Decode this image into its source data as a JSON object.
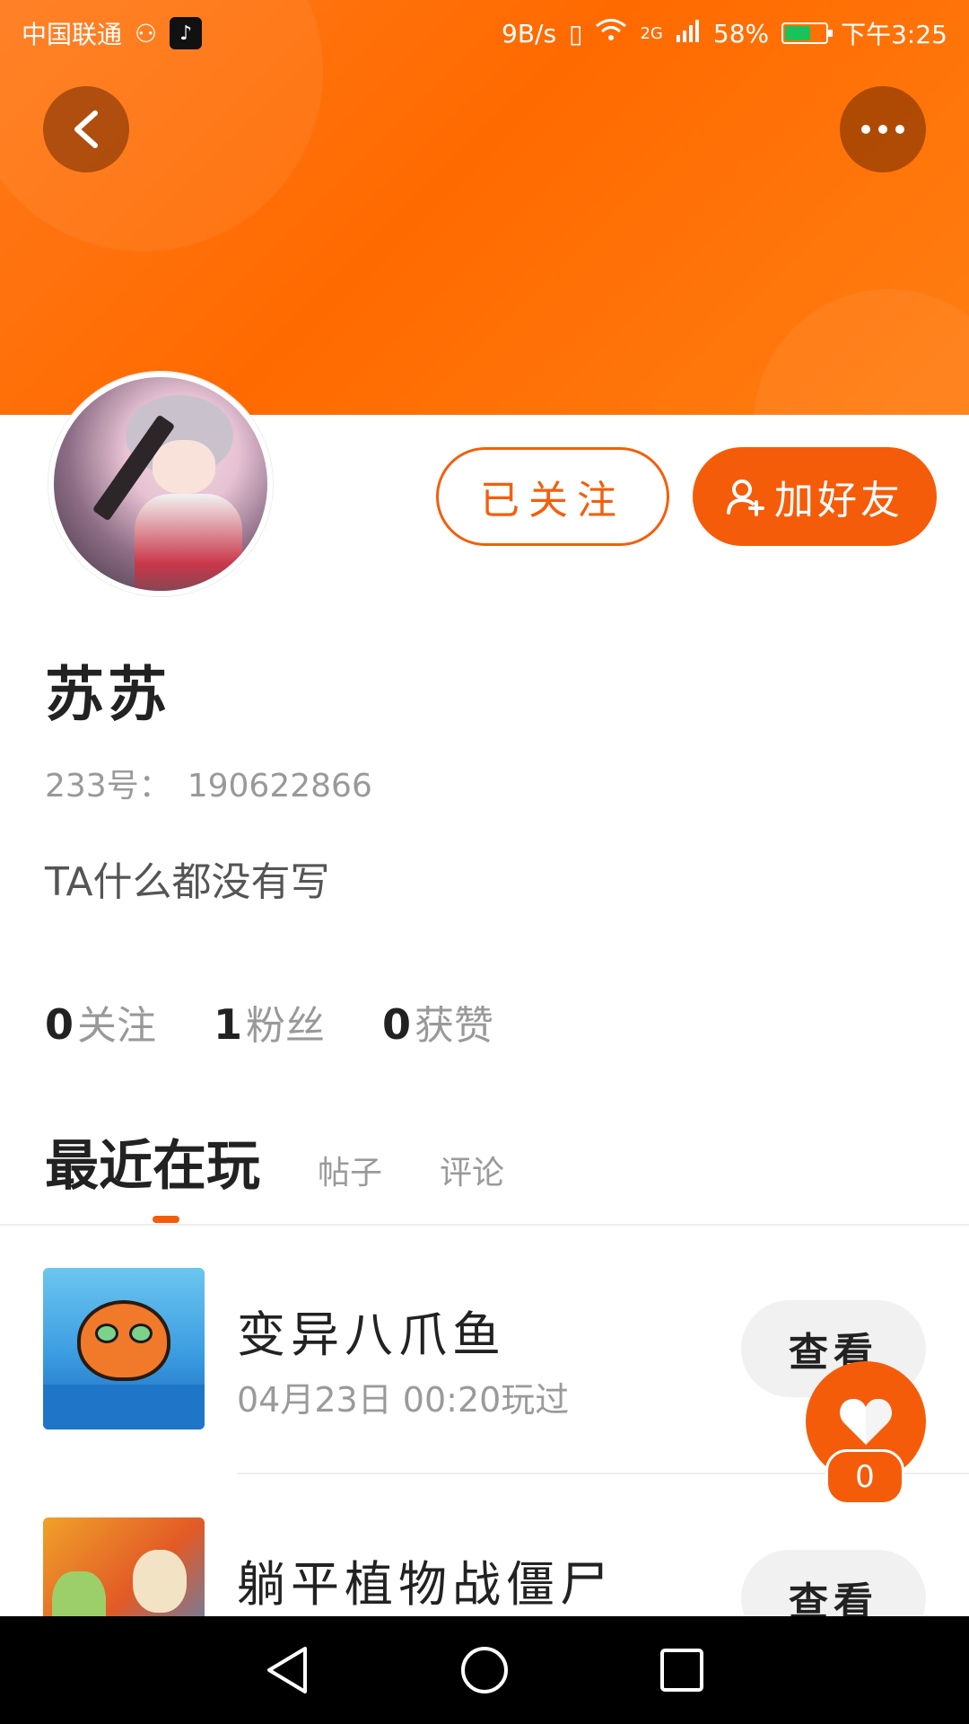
{
  "status_bar": {
    "carrier": "中国联通",
    "net_speed": "9B/s",
    "network": "2G",
    "battery": "58%",
    "time": "下午3:25"
  },
  "profile": {
    "name": "苏苏",
    "id_label": "233号：",
    "id_value": "190622866",
    "bio": "TA什么都没有写",
    "follow_button": "已关注",
    "add_friend_button": "加好友"
  },
  "stats": [
    {
      "count": "0",
      "label": "关注"
    },
    {
      "count": "1",
      "label": "粉丝"
    },
    {
      "count": "0",
      "label": "获赞"
    }
  ],
  "tabs": [
    {
      "label": "最近在玩",
      "active": true
    },
    {
      "label": "帖子",
      "active": false
    },
    {
      "label": "评论",
      "active": false
    }
  ],
  "games": [
    {
      "title": "变异八爪鱼",
      "time": "04月23日  00:20玩过",
      "button": "查看"
    },
    {
      "title": "躺平植物战僵尸",
      "button": "查看"
    }
  ],
  "like": {
    "count": "0"
  },
  "colors": {
    "accent": "#f55c0a",
    "header": "#ff6a00"
  },
  "icons": [
    "back-arrow-icon",
    "more-dots-icon",
    "add-user-icon",
    "heart-icon",
    "nav-back-icon",
    "nav-home-icon",
    "nav-recents-icon"
  ]
}
